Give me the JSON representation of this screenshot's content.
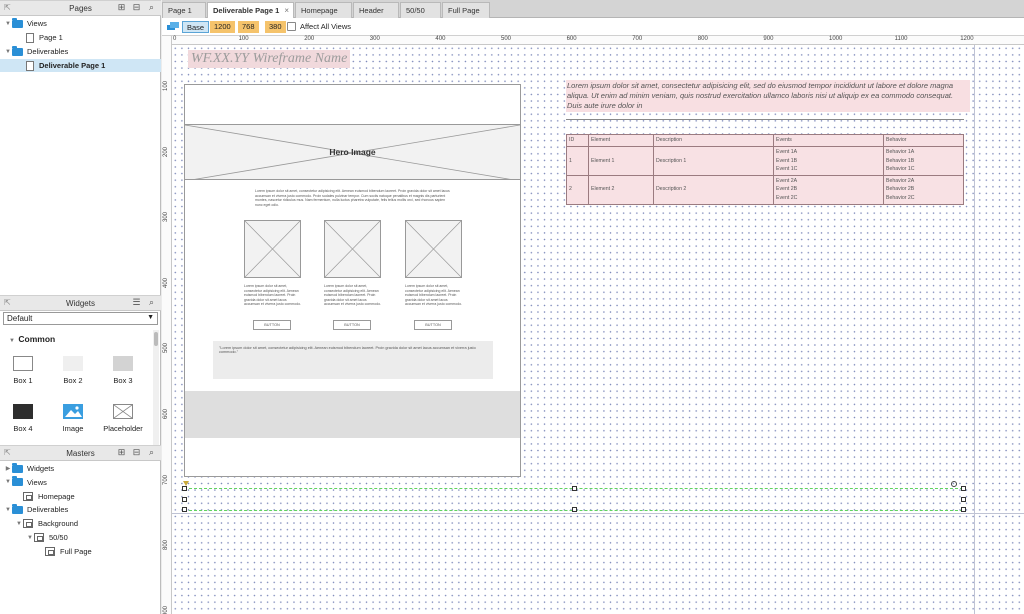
{
  "pages_panel": {
    "title": "Pages",
    "items": [
      {
        "label": "Views",
        "type": "folder",
        "depth": 0,
        "expanded": true
      },
      {
        "label": "Page 1",
        "type": "page",
        "depth": 1
      },
      {
        "label": "Deliverables",
        "type": "folder",
        "depth": 0,
        "expanded": true
      },
      {
        "label": "Deliverable Page 1",
        "type": "page",
        "depth": 1,
        "selected": true
      }
    ]
  },
  "widgets_panel": {
    "title": "Widgets",
    "library": "Default",
    "group": "Common",
    "items": [
      {
        "label": "Box 1",
        "icon": "box-outline-icon"
      },
      {
        "label": "Box 2",
        "icon": "box-light-icon"
      },
      {
        "label": "Box 3",
        "icon": "box-gray-icon"
      },
      {
        "label": "Box 4",
        "icon": "box-dark-icon"
      },
      {
        "label": "Image",
        "icon": "image-icon"
      },
      {
        "label": "Placeholder",
        "icon": "placeholder-icon"
      }
    ]
  },
  "masters_panel": {
    "title": "Masters",
    "items": [
      {
        "label": "Widgets",
        "type": "folder",
        "depth": 0,
        "expanded": false
      },
      {
        "label": "Views",
        "type": "folder",
        "depth": 0,
        "expanded": true
      },
      {
        "label": "Homepage",
        "type": "master",
        "depth": 1
      },
      {
        "label": "Deliverables",
        "type": "folder",
        "depth": 0,
        "expanded": true
      },
      {
        "label": "Background",
        "type": "master",
        "depth": 1,
        "expanded": true
      },
      {
        "label": "50/50",
        "type": "master",
        "depth": 2,
        "expanded": true
      },
      {
        "label": "Full Page",
        "type": "master",
        "depth": 3
      }
    ]
  },
  "tabs": [
    {
      "label": "Page 1",
      "active": false
    },
    {
      "label": "Deliverable Page 1",
      "active": true
    },
    {
      "label": "Homepage",
      "active": false
    },
    {
      "label": "Header",
      "active": false
    },
    {
      "label": "50/50",
      "active": false
    },
    {
      "label": "Full Page",
      "active": false
    }
  ],
  "toolbar": {
    "base_label": "Base",
    "breakpoints": [
      "1200",
      "768",
      "380"
    ],
    "affect_all_views": "Affect All Views",
    "affect_all_checked": false
  },
  "rulers": {
    "horizontal": [
      "0",
      "100",
      "200",
      "300",
      "400",
      "500",
      "600",
      "700",
      "800",
      "900",
      "1000",
      "1100",
      "1200"
    ],
    "vertical": [
      "100",
      "200",
      "300",
      "400",
      "500",
      "600",
      "700",
      "800",
      "900"
    ]
  },
  "canvas": {
    "wireframe_title": "WF.XX.YY Wireframe Name",
    "hero_label": "Hero Image",
    "intro_text": "Lorem ipsum dolor sit amet, consectetur adipisicing elit. Aenean euismod bibendum laoreet. Proin gravida dolor sit amet lacus accumsan et viverra justo commodo. Proin sodales pulvinar tempor. Cum sociis natoque penatibus et magnis dis parturient montes, nascetur ridiculus mus. Nam fermentum, nulla luctus pharetra vulputate, felis tellus mollis orci, sed rhoncus sapien nunc eget odio.",
    "column_text": "Lorem ipsum dolor sit amet, consectetur adipisicing elit. Aenean euismod bibendum laoreet. Proin gravida dolor sit amet lacus accumsan et viverra justo commodo.",
    "button_label": "BUTTON",
    "quote_text": "\"Lorem ipsum dolor sit amet, consectetur adipisicing elit. Aenean euismod bibendum laoreet. Proin gravida dolor sit amet lacus accumsan et viverra justo commodo.\"",
    "annotation": "Lorem ipsum dolor sit amet, consectetur adipisicing elit, sed do eiusmod tempor incididunt ut labore et dolore magna aliqua. Ut enim ad minim veniam, quis nostrud exercitation ullamco laboris nisi ut aliquip ex ea commodo consequat. Duis aute irure dolor in",
    "table": {
      "headers": [
        "ID",
        "Element",
        "Description",
        "Events",
        "Behavior"
      ],
      "rows": [
        {
          "id": "1",
          "element": "Element 1",
          "description": "Description 1",
          "events": [
            "Event 1A",
            "Event 1B",
            "Event 1C"
          ],
          "behavior": [
            "Behavior 1A",
            "Behavior 1B",
            "Behavior 1C"
          ]
        },
        {
          "id": "2",
          "element": "Element 2",
          "description": "Description 2",
          "events": [
            "Event 2A",
            "Event 2B",
            "Event 2C"
          ],
          "behavior": [
            "Behavior 2A",
            "Behavior 2B",
            "Behavior 2C"
          ]
        }
      ]
    }
  },
  "colors": {
    "accent": "#2a8fd6",
    "selected_row": "#cfe6f5",
    "breakpoint": "#f5c36b",
    "annotation_bg": "#f8dfe2",
    "selection_line": "#5fd45f"
  }
}
